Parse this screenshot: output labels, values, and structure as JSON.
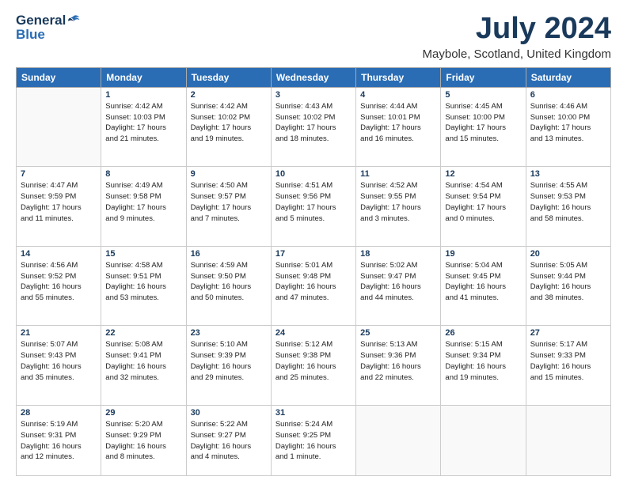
{
  "header": {
    "logo_general": "General",
    "logo_blue": "Blue",
    "month_year": "July 2024",
    "location": "Maybole, Scotland, United Kingdom"
  },
  "weekdays": [
    "Sunday",
    "Monday",
    "Tuesday",
    "Wednesday",
    "Thursday",
    "Friday",
    "Saturday"
  ],
  "weeks": [
    [
      {
        "day": "",
        "info": ""
      },
      {
        "day": "1",
        "info": "Sunrise: 4:42 AM\nSunset: 10:03 PM\nDaylight: 17 hours\nand 21 minutes."
      },
      {
        "day": "2",
        "info": "Sunrise: 4:42 AM\nSunset: 10:02 PM\nDaylight: 17 hours\nand 19 minutes."
      },
      {
        "day": "3",
        "info": "Sunrise: 4:43 AM\nSunset: 10:02 PM\nDaylight: 17 hours\nand 18 minutes."
      },
      {
        "day": "4",
        "info": "Sunrise: 4:44 AM\nSunset: 10:01 PM\nDaylight: 17 hours\nand 16 minutes."
      },
      {
        "day": "5",
        "info": "Sunrise: 4:45 AM\nSunset: 10:00 PM\nDaylight: 17 hours\nand 15 minutes."
      },
      {
        "day": "6",
        "info": "Sunrise: 4:46 AM\nSunset: 10:00 PM\nDaylight: 17 hours\nand 13 minutes."
      }
    ],
    [
      {
        "day": "7",
        "info": "Sunrise: 4:47 AM\nSunset: 9:59 PM\nDaylight: 17 hours\nand 11 minutes."
      },
      {
        "day": "8",
        "info": "Sunrise: 4:49 AM\nSunset: 9:58 PM\nDaylight: 17 hours\nand 9 minutes."
      },
      {
        "day": "9",
        "info": "Sunrise: 4:50 AM\nSunset: 9:57 PM\nDaylight: 17 hours\nand 7 minutes."
      },
      {
        "day": "10",
        "info": "Sunrise: 4:51 AM\nSunset: 9:56 PM\nDaylight: 17 hours\nand 5 minutes."
      },
      {
        "day": "11",
        "info": "Sunrise: 4:52 AM\nSunset: 9:55 PM\nDaylight: 17 hours\nand 3 minutes."
      },
      {
        "day": "12",
        "info": "Sunrise: 4:54 AM\nSunset: 9:54 PM\nDaylight: 17 hours\nand 0 minutes."
      },
      {
        "day": "13",
        "info": "Sunrise: 4:55 AM\nSunset: 9:53 PM\nDaylight: 16 hours\nand 58 minutes."
      }
    ],
    [
      {
        "day": "14",
        "info": "Sunrise: 4:56 AM\nSunset: 9:52 PM\nDaylight: 16 hours\nand 55 minutes."
      },
      {
        "day": "15",
        "info": "Sunrise: 4:58 AM\nSunset: 9:51 PM\nDaylight: 16 hours\nand 53 minutes."
      },
      {
        "day": "16",
        "info": "Sunrise: 4:59 AM\nSunset: 9:50 PM\nDaylight: 16 hours\nand 50 minutes."
      },
      {
        "day": "17",
        "info": "Sunrise: 5:01 AM\nSunset: 9:48 PM\nDaylight: 16 hours\nand 47 minutes."
      },
      {
        "day": "18",
        "info": "Sunrise: 5:02 AM\nSunset: 9:47 PM\nDaylight: 16 hours\nand 44 minutes."
      },
      {
        "day": "19",
        "info": "Sunrise: 5:04 AM\nSunset: 9:45 PM\nDaylight: 16 hours\nand 41 minutes."
      },
      {
        "day": "20",
        "info": "Sunrise: 5:05 AM\nSunset: 9:44 PM\nDaylight: 16 hours\nand 38 minutes."
      }
    ],
    [
      {
        "day": "21",
        "info": "Sunrise: 5:07 AM\nSunset: 9:43 PM\nDaylight: 16 hours\nand 35 minutes."
      },
      {
        "day": "22",
        "info": "Sunrise: 5:08 AM\nSunset: 9:41 PM\nDaylight: 16 hours\nand 32 minutes."
      },
      {
        "day": "23",
        "info": "Sunrise: 5:10 AM\nSunset: 9:39 PM\nDaylight: 16 hours\nand 29 minutes."
      },
      {
        "day": "24",
        "info": "Sunrise: 5:12 AM\nSunset: 9:38 PM\nDaylight: 16 hours\nand 25 minutes."
      },
      {
        "day": "25",
        "info": "Sunrise: 5:13 AM\nSunset: 9:36 PM\nDaylight: 16 hours\nand 22 minutes."
      },
      {
        "day": "26",
        "info": "Sunrise: 5:15 AM\nSunset: 9:34 PM\nDaylight: 16 hours\nand 19 minutes."
      },
      {
        "day": "27",
        "info": "Sunrise: 5:17 AM\nSunset: 9:33 PM\nDaylight: 16 hours\nand 15 minutes."
      }
    ],
    [
      {
        "day": "28",
        "info": "Sunrise: 5:19 AM\nSunset: 9:31 PM\nDaylight: 16 hours\nand 12 minutes."
      },
      {
        "day": "29",
        "info": "Sunrise: 5:20 AM\nSunset: 9:29 PM\nDaylight: 16 hours\nand 8 minutes."
      },
      {
        "day": "30",
        "info": "Sunrise: 5:22 AM\nSunset: 9:27 PM\nDaylight: 16 hours\nand 4 minutes."
      },
      {
        "day": "31",
        "info": "Sunrise: 5:24 AM\nSunset: 9:25 PM\nDaylight: 16 hours\nand 1 minute."
      },
      {
        "day": "",
        "info": ""
      },
      {
        "day": "",
        "info": ""
      },
      {
        "day": "",
        "info": ""
      }
    ]
  ]
}
